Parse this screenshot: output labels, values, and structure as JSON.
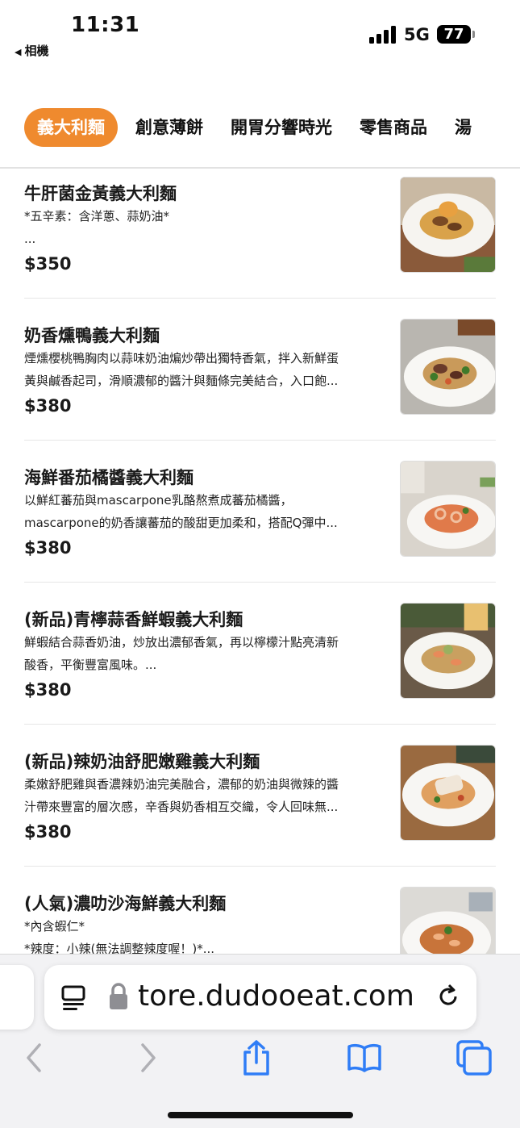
{
  "status_bar": {
    "time": "11:31",
    "back_label": "相機",
    "network": "5G",
    "battery": "77"
  },
  "categories": [
    {
      "label": "義大利麵",
      "active": true
    },
    {
      "label": "創意薄餅",
      "active": false
    },
    {
      "label": "開胃分響時光",
      "active": false
    },
    {
      "label": "零售商品",
      "active": false
    },
    {
      "label": "湯",
      "active": false
    }
  ],
  "menu_items": [
    {
      "name": "牛肝菌金黃義大利麵",
      "desc_lines": [
        "*五辛素：含洋蔥、蒜奶油*",
        "..."
      ],
      "price": "$350"
    },
    {
      "name": "奶香燻鴨義大利麵",
      "desc_lines": [
        "煙燻櫻桃鴨胸肉以蒜味奶油煸炒帶出獨特香氣，拌入新鮮蛋",
        "黃與鹹香起司，滑順濃郁的醬汁與麵條完美結合，入口飽..."
      ],
      "price": "$380"
    },
    {
      "name": "海鮮番茄橘醬義大利麵",
      "desc_lines": [
        "以鮮紅蕃茄與mascarpone乳酪熬煮成蕃茄橘醬，",
        "mascarpone的奶香讓蕃茄的酸甜更加柔和，搭配Q彈中..."
      ],
      "price": "$380"
    },
    {
      "name": "(新品)青檸蒜香鮮蝦義大利麵",
      "desc_lines": [
        "鮮蝦結合蒜香奶油，炒放出濃郁香氣，再以檸檬汁點亮清新",
        "酸香，平衡豐富風味。..."
      ],
      "price": "$380"
    },
    {
      "name": "(新品)辣奶油舒肥嫩雞義大利麵",
      "desc_lines": [
        "柔嫩舒肥雞與香濃辣奶油完美融合，濃郁的奶油與微辣的醬",
        "汁帶來豐富的層次感，辛香與奶香相互交織，令人回味無..."
      ],
      "price": "$380"
    },
    {
      "name": "(人氣)濃叻沙海鮮義大利麵",
      "desc_lines": [
        "*內含蝦仁*",
        "*辣度：小辣(無法調整辣度喔！)*..."
      ],
      "price": ""
    }
  ],
  "browser": {
    "url": "tore.dudooeat.com"
  },
  "colors": {
    "accent": "#ef8a2e",
    "ios_blue": "#2f7df6"
  }
}
